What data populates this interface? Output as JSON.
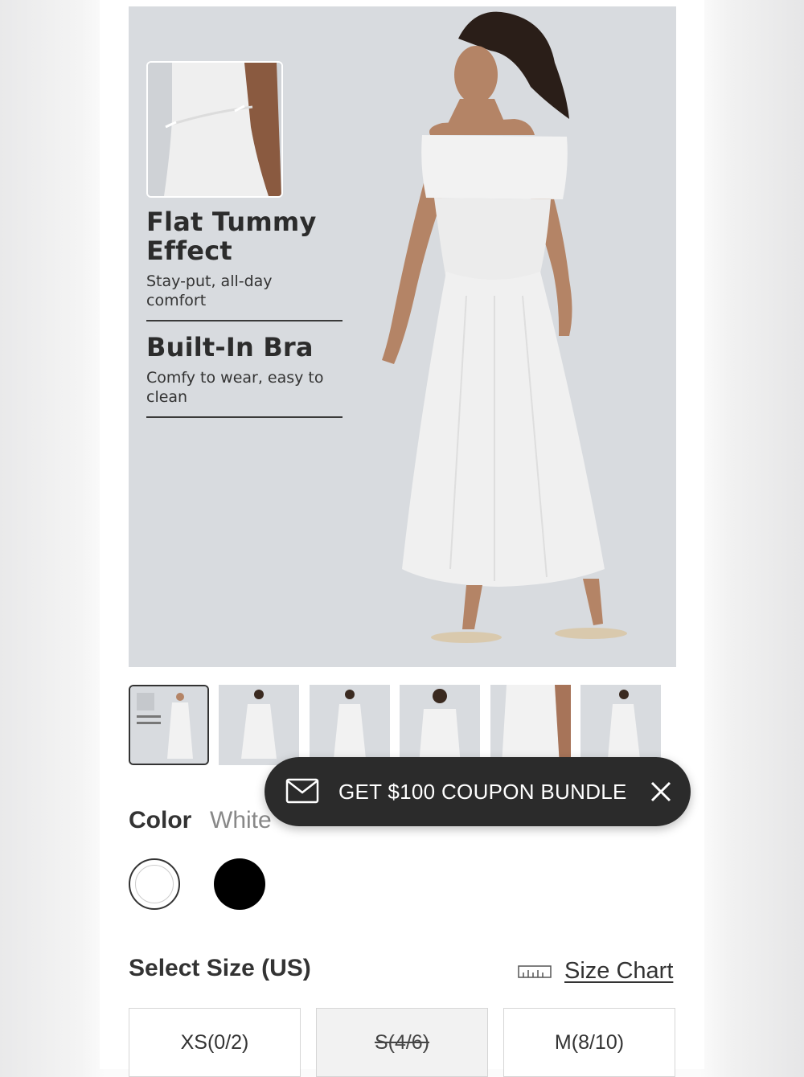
{
  "hero": {
    "features": [
      {
        "title": "Flat Tummy Effect",
        "subtitle": "Stay-put, all-day comfort"
      },
      {
        "title": "Built-In Bra",
        "subtitle": "Comfy to wear, easy to clean"
      }
    ]
  },
  "thumbnails": {
    "count": 6,
    "active_index": 0
  },
  "coupon": {
    "label": "GET $100 COUPON BUNDLE",
    "icon": "envelope-icon",
    "close_icon": "close-icon"
  },
  "color": {
    "label": "Color",
    "selected": "White",
    "options": [
      {
        "name": "White",
        "hex": "#ffffff"
      },
      {
        "name": "Black",
        "hex": "#000000"
      }
    ]
  },
  "size": {
    "label": "Select Size (US)",
    "chart_label": "Size Chart",
    "chart_icon": "ruler-icon",
    "options": [
      {
        "label": "XS(0/2)",
        "available": true
      },
      {
        "label": "S(4/6)",
        "available": false
      },
      {
        "label": "M(8/10)",
        "available": true
      }
    ]
  },
  "colors": {
    "hero_bg": "#d8dbdf",
    "coupon_bg": "#2b2b2b",
    "text": "#333333"
  }
}
